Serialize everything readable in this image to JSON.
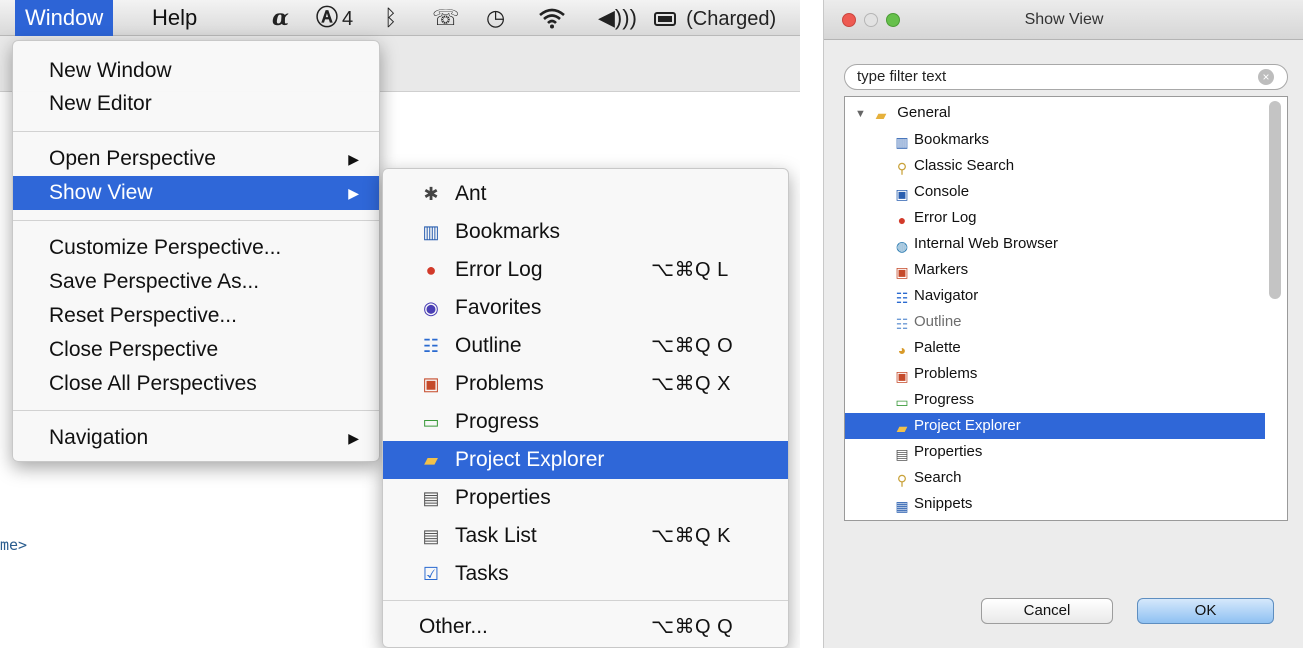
{
  "menubar": {
    "window": "Window",
    "help": "Help",
    "icons": [
      "alfred-icon",
      "adobe-icon",
      "bluetooth-icon",
      "phone-icon",
      "time-machine-icon",
      "wifi-icon",
      "volume-icon",
      "battery-icon"
    ],
    "adobe_count": "4",
    "battery_status": "(Charged)"
  },
  "window_menu": {
    "items": [
      "New Window",
      "New Editor",
      "Open Perspective",
      "Show View",
      "Customize Perspective...",
      "Save Perspective As...",
      "Reset Perspective...",
      "Close Perspective",
      "Close All Perspectives",
      "Navigation"
    ]
  },
  "show_view_menu": {
    "items": [
      {
        "label": "Ant",
        "icon": "ant-icon",
        "shortcut": ""
      },
      {
        "label": "Bookmarks",
        "icon": "bookmarks-icon",
        "shortcut": ""
      },
      {
        "label": "Error Log",
        "icon": "error-log-icon",
        "shortcut": "⌥⌘Q L"
      },
      {
        "label": "Favorites",
        "icon": "favorites-icon",
        "shortcut": ""
      },
      {
        "label": "Outline",
        "icon": "outline-icon",
        "shortcut": "⌥⌘Q O"
      },
      {
        "label": "Problems",
        "icon": "problems-icon",
        "shortcut": "⌥⌘Q X"
      },
      {
        "label": "Progress",
        "icon": "progress-icon",
        "shortcut": ""
      },
      {
        "label": "Project Explorer",
        "icon": "project-explorer-icon",
        "shortcut": ""
      },
      {
        "label": "Properties",
        "icon": "properties-icon",
        "shortcut": ""
      },
      {
        "label": "Task List",
        "icon": "task-list-icon",
        "shortcut": "⌥⌘Q K"
      },
      {
        "label": "Tasks",
        "icon": "tasks-icon",
        "shortcut": ""
      },
      {
        "label": "Other...",
        "icon": "",
        "shortcut": "⌥⌘Q Q"
      }
    ]
  },
  "editor": {
    "fragment": "me>"
  },
  "dialog": {
    "title": "Show View",
    "filter_placeholder": "type filter text",
    "tree": {
      "root": "General",
      "items": [
        "Bookmarks",
        "Classic Search",
        "Console",
        "Error Log",
        "Internal Web Browser",
        "Markers",
        "Navigator",
        "Outline",
        "Palette",
        "Problems",
        "Progress",
        "Project Explorer",
        "Properties",
        "Search",
        "Snippets"
      ]
    },
    "cancel": "Cancel",
    "ok": "OK"
  },
  "colors": {
    "selection": "#2f67d8",
    "menubar_active": "#2d64d6"
  }
}
